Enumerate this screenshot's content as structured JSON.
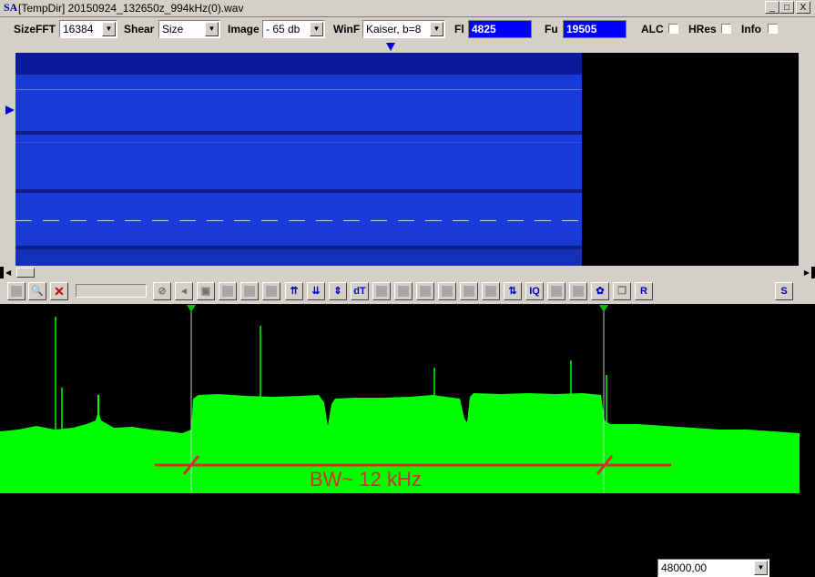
{
  "window": {
    "icon": "SA",
    "title": "[TempDir] 20150924_132650z_994kHz(0).wav",
    "buttons": [
      "_",
      "□",
      "X"
    ]
  },
  "controls": {
    "sizefft_label": "SizeFFT",
    "sizefft_value": "16384",
    "shear_label": "Shear",
    "shear_value": "Size",
    "image_label": "Image",
    "image_value": "- 65 db",
    "winf_label": "WinF",
    "winf_value": "Kaiser, b=8",
    "fl_label": "Fl",
    "fl_value": "4825",
    "fu_label": "Fu",
    "fu_value": "19505",
    "alc_label": "ALC",
    "hres_label": "HRes",
    "info_label": "Info"
  },
  "toolbar": {
    "icons": [
      "square-icon",
      "zoom-icon",
      "no-zoom-icon",
      "cancel-icon",
      "marker-icon",
      "frame-icon",
      "shape-icon",
      "shape-icon",
      "shape-icon",
      "align-top-icon",
      "align-bottom-icon",
      "align-both-icon",
      "dt-icon",
      "square-icon",
      "square-icon",
      "square-icon",
      "square-icon",
      "square-icon",
      "square-icon",
      "arrows-icon",
      "iq-icon",
      "square-icon",
      "square-icon",
      "gear-icon",
      "copy-icon",
      "r-icon"
    ],
    "dt_label": "dT",
    "iq_label": "IQ",
    "r_label": "R",
    "rate_value": "48000,00",
    "s_label": "S"
  },
  "annotation": {
    "bw_text": "BW~ 12 kHz"
  },
  "colors": {
    "spectrum": "#00ff00",
    "annotation": "#d03030",
    "waterfall": "#1a3ad8",
    "fl_fu_box": "#0000ff"
  }
}
